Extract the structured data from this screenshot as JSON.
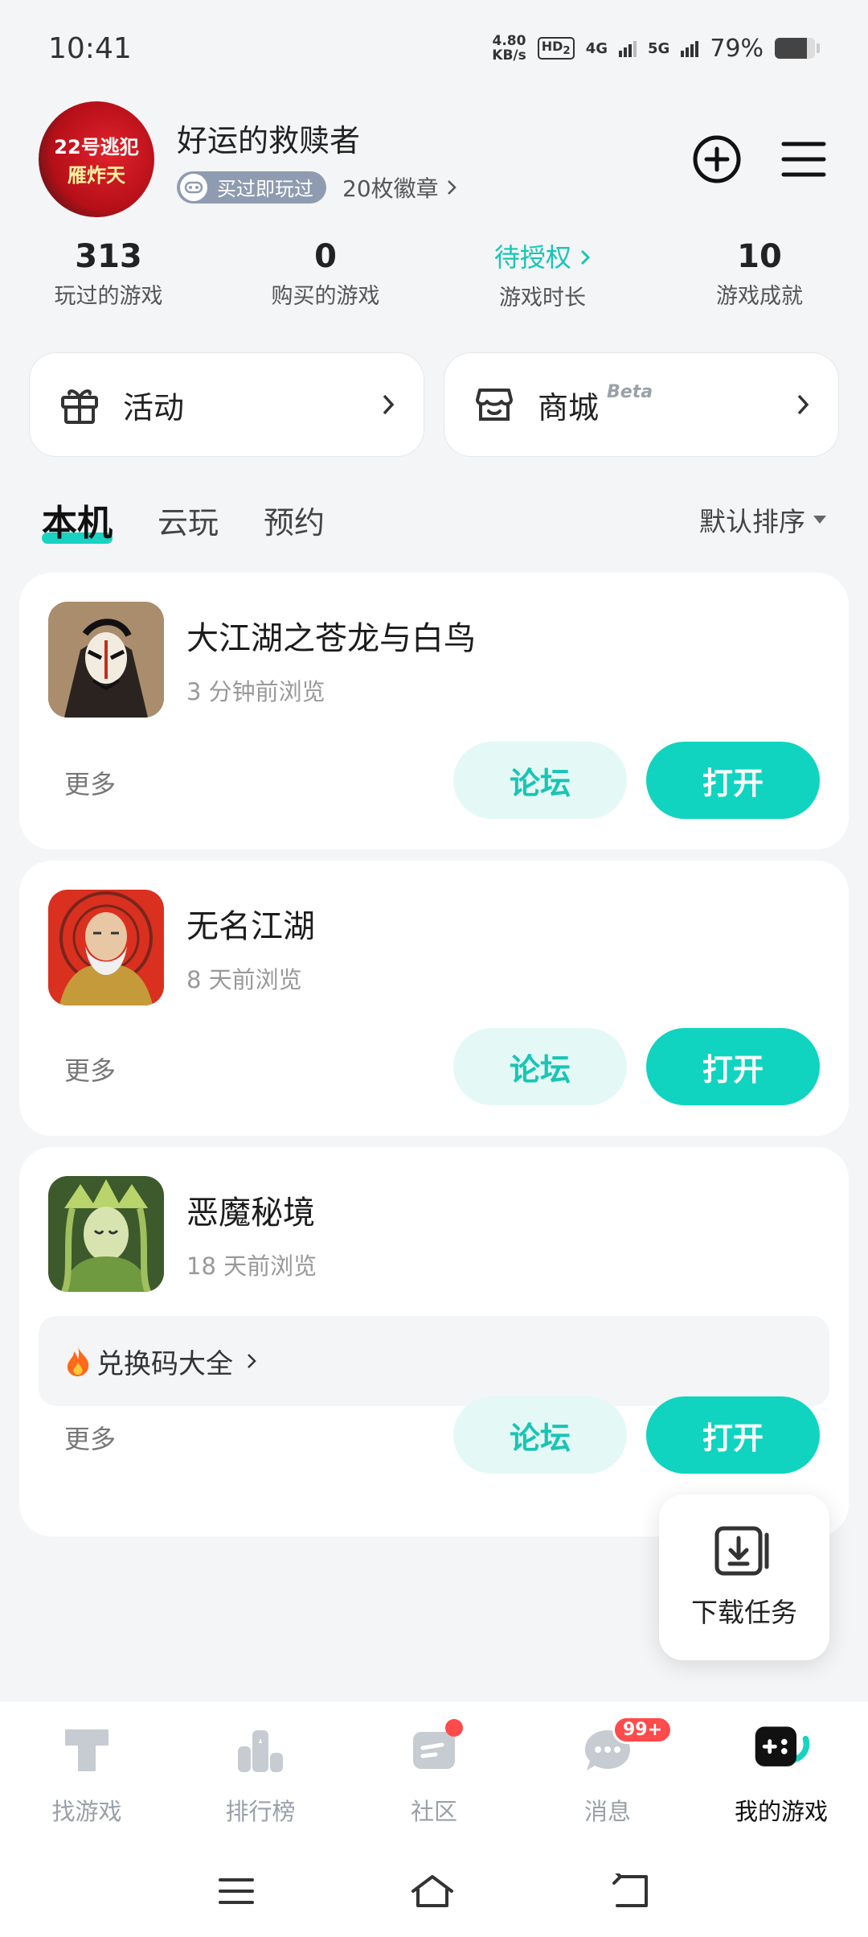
{
  "status_bar": {
    "time": "10:41",
    "net_speed_value": "4.80",
    "net_speed_unit": "KB/s",
    "hd_label": "HD",
    "hd_sub": "2",
    "signal1_label": "4G",
    "signal2_label": "5G",
    "battery": "79%",
    "battery_level": 0.79
  },
  "profile": {
    "username": "好运的救赎者",
    "avatar_text_line1": "22号逃犯",
    "avatar_text_line2": "雁炸天",
    "pill_label": "买过即玩过",
    "badges": "20枚徽章"
  },
  "stats": [
    {
      "value": "313",
      "label": "玩过的游戏"
    },
    {
      "value": "0",
      "label": "购买的游戏"
    },
    {
      "value": "待授权",
      "label": "游戏时长"
    },
    {
      "value": "10",
      "label": "游戏成就"
    }
  ],
  "shortcuts": {
    "activity": "活动",
    "store": "商城",
    "store_tag": "Beta"
  },
  "tabs": {
    "items": [
      "本机",
      "云玩",
      "预约"
    ],
    "sort": "默认排序"
  },
  "games": [
    {
      "title": "大江湖之苍龙与白鸟",
      "time": "3 分钟前浏览",
      "more": "更多",
      "forum": "论坛",
      "open": "打开"
    },
    {
      "title": "无名江湖",
      "time": "8 天前浏览",
      "more": "更多",
      "forum": "论坛",
      "open": "打开"
    },
    {
      "title": "恶魔秘境",
      "time": "18 天前浏览",
      "more": "更多",
      "forum": "论坛",
      "open": "打开",
      "redeem": "兑换码大全"
    }
  ],
  "download_task": "下载任务",
  "bottom_nav": {
    "items": [
      "找游戏",
      "排行榜",
      "社区",
      "消息",
      "我的游戏"
    ],
    "message_badge": "99+"
  },
  "colors": {
    "accent": "#10d4c0",
    "accent_text": "#19c5b4",
    "badge_red": "#ff4b4b"
  }
}
